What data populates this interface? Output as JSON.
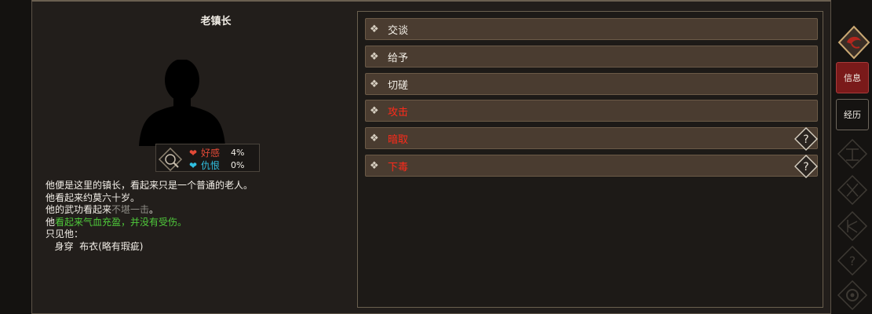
{
  "npc": {
    "name": "老镇长"
  },
  "relations": {
    "favor": {
      "heart": "❤",
      "label": "好感",
      "value": "4%"
    },
    "hate": {
      "heart": "❤",
      "label": "仇恨",
      "value": "0%"
    }
  },
  "description": {
    "line1": "他便是这里的镇长，看起来只是一个普通的老人。",
    "line2": "他看起来约莫六十岁。",
    "line3_prefix": "他的武功看起来",
    "line3_gray": "不堪一击",
    "line3_suffix": "。",
    "line4_prefix": "他",
    "line4_green": "看起来气血充盈，并没有受伤。",
    "line5": "只见他：",
    "line6": "   身穿  布衣(略有瑕疵)"
  },
  "actions": [
    {
      "label": "交谈",
      "style": "normal",
      "help": false
    },
    {
      "label": "给予",
      "style": "normal",
      "help": false
    },
    {
      "label": "切磋",
      "style": "normal",
      "help": false
    },
    {
      "label": "攻击",
      "style": "red",
      "help": false
    },
    {
      "label": "暗取",
      "style": "red",
      "help": true
    },
    {
      "label": "下毒",
      "style": "red",
      "help": true
    }
  ],
  "icons": {
    "action_bullet": "diamond-bullet-icon",
    "help": "question-diamond-icon"
  },
  "sidebar": {
    "tab_info": "信息",
    "tab_history": "经历"
  },
  "colors": {
    "red_action": "#ff2a1a",
    "favor": "#e34a37",
    "hate": "#30bfe0",
    "healthy": "#4fc93b",
    "weak": "#8e8c86",
    "active_tab": "#7a1a1a"
  }
}
